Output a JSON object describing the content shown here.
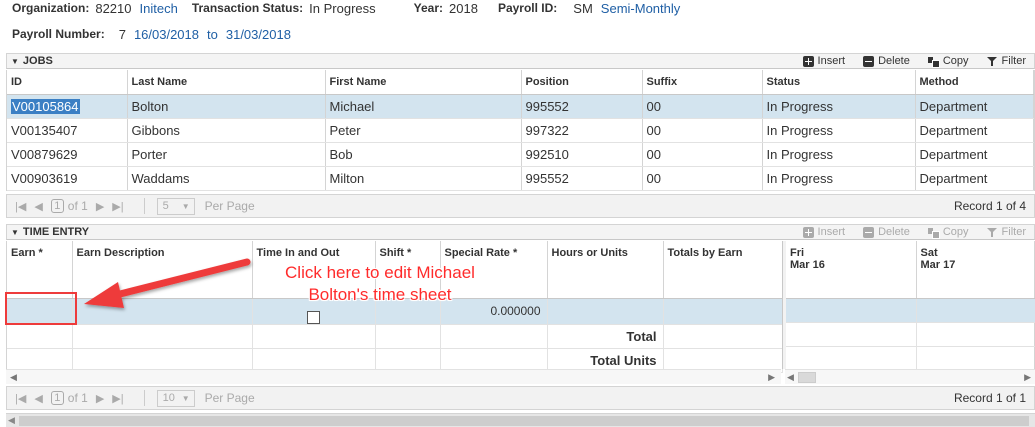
{
  "header": {
    "org_label": "Organization:",
    "org_code": "82210",
    "org_name": "Initech",
    "status_label": "Transaction Status:",
    "status_value": "In Progress",
    "year_label": "Year:",
    "year_value": "2018",
    "payroll_id_label": "Payroll ID:",
    "payroll_id_code": "SM",
    "payroll_id_name": "Semi-Monthly",
    "payroll_number_label": "Payroll Number:",
    "payroll_number_value": "7",
    "date_from": "16/03/2018",
    "date_to_label": "to",
    "date_to": "31/03/2018"
  },
  "toolbar": {
    "insert": "Insert",
    "delete": "Delete",
    "copy": "Copy",
    "filter": "Filter"
  },
  "jobs": {
    "title": "JOBS",
    "columns": [
      "ID",
      "Last Name",
      "First Name",
      "Position",
      "Suffix",
      "Status",
      "Method"
    ],
    "rows": [
      [
        "V00105864",
        "Bolton",
        "Michael",
        "995552",
        "00",
        "In Progress",
        "Department"
      ],
      [
        "V00135407",
        "Gibbons",
        "Peter",
        "997322",
        "00",
        "In Progress",
        "Department"
      ],
      [
        "V00879629",
        "Porter",
        "Bob",
        "992510",
        "00",
        "In Progress",
        "Department"
      ],
      [
        "V00903619",
        "Waddams",
        "Milton",
        "995552",
        "00",
        "In Progress",
        "Department"
      ]
    ],
    "pager": {
      "page": "1",
      "of_label": "of 1",
      "per_page_value": "5",
      "per_page_label": "Per Page",
      "record_text": "Record 1 of 4"
    }
  },
  "time_entry": {
    "title": "TIME ENTRY",
    "columns": [
      "Earn *",
      "Earn Description",
      "Time In and Out",
      "Shift *",
      "Special Rate *",
      "Hours or Units",
      "Totals by Earn"
    ],
    "day_columns": [
      {
        "day": "Fri",
        "date": "Mar 16"
      },
      {
        "day": "Sat",
        "date": "Mar 17"
      }
    ],
    "special_rate_value": "0.000000",
    "total_label": "Total",
    "total_units_label": "Total Units",
    "pager": {
      "page": "1",
      "of_label": "of 1",
      "per_page_value": "10",
      "per_page_label": "Per Page",
      "record_text": "Record 1 of 1"
    }
  },
  "annotation": {
    "line1": "Click here to edit Michael",
    "line2": "Bolton's time sheet",
    "color": "#ee3b3b"
  }
}
